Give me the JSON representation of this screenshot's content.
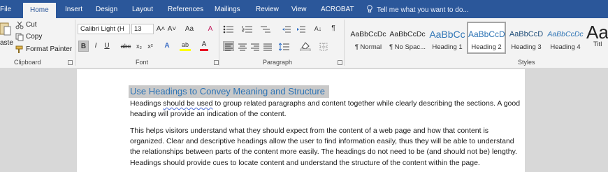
{
  "tabs": {
    "file": "File",
    "home": "Home",
    "insert": "Insert",
    "design": "Design",
    "layout": "Layout",
    "references": "References",
    "mailings": "Mailings",
    "review": "Review",
    "view": "View",
    "acrobat": "ACROBAT"
  },
  "tell_me": "Tell me what you want to do...",
  "clipboard": {
    "paste": "aste",
    "cut": "Cut",
    "copy": "Copy",
    "format_painter": "Format Painter",
    "label": "Clipboard"
  },
  "font": {
    "name": "Calibri Light (H",
    "size": "13",
    "grow": "A˄",
    "shrink": "A˅",
    "case": "Aa",
    "clear": "A",
    "bold": "B",
    "italic": "I",
    "underline": "U",
    "strike": "abc",
    "subscript": "x₂",
    "superscript": "x²",
    "effects": "A",
    "highlight": "ab",
    "color": "A",
    "label": "Font"
  },
  "paragraph": {
    "pilcrow": "¶",
    "sort": "A↓",
    "label": "Paragraph"
  },
  "styles": {
    "label": "Styles",
    "items": [
      {
        "preview": "AaBbCcDc",
        "name": "¶ Normal"
      },
      {
        "preview": "AaBbCcDc",
        "name": "¶ No Spac..."
      },
      {
        "preview": "AaBbCc",
        "name": "Heading 1"
      },
      {
        "preview": "AaBbCcD",
        "name": "Heading 2"
      },
      {
        "preview": "AaBbCcD",
        "name": "Heading 3"
      },
      {
        "preview": "AaBbCcDc",
        "name": "Heading 4"
      },
      {
        "preview": "Aa",
        "name": "Titl"
      }
    ]
  },
  "document": {
    "heading": "Use Headings to Convey Meaning and Structure",
    "p1_before": "Headings ",
    "p1_flag": "should be used",
    "p1_after": " to group related paragraphs and content together while clearly describing the sections. A good heading will provide an indication of the content.",
    "p2": "This helps visitors understand what they should expect from the content of a web page and how that content is organized. Clear and descriptive headings allow the user to find information easily, thus they will be able to understand the relationships between parts of the content more easily. The headings do not need to be (and should not be) lengthy. Headings should provide cues to locate content and understand the structure of the content within the page."
  },
  "colors": {
    "ribbon_blue": "#2b579a",
    "heading_blue": "#2e74b5",
    "highlight_red": "#e81123",
    "highlight_yellow": "#ffff00"
  }
}
